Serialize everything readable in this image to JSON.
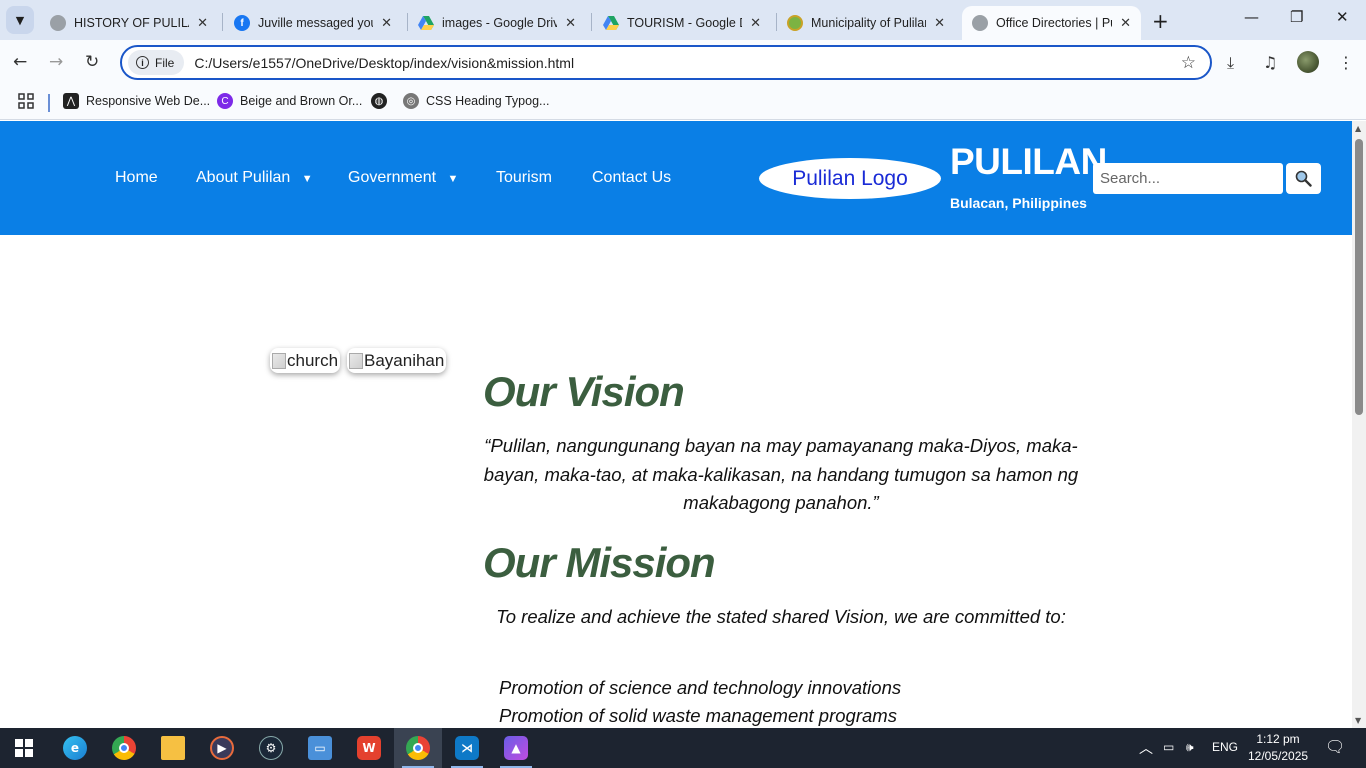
{
  "browser": {
    "tabs": [
      {
        "title": "HISTORY OF PULILAN",
        "icon": "globe-icon"
      },
      {
        "title": "Juville messaged you",
        "icon": "facebook-icon"
      },
      {
        "title": "images - Google Drive",
        "icon": "google-drive-icon"
      },
      {
        "title": "TOURISM - Google Drive",
        "icon": "google-drive-icon"
      },
      {
        "title": "Municipality of Pulilan",
        "icon": "pulilan-seal-icon"
      },
      {
        "title": "Office Directories | Pulilan",
        "icon": "globe-icon",
        "active": true
      }
    ],
    "omnibox": {
      "chip_label": "File",
      "url": "C:/Users/e1557/OneDrive/Desktop/index/vision&mission.html"
    },
    "bookmarks": [
      {
        "label": "Responsive Web De...",
        "icon": "web-design-icon"
      },
      {
        "label": "Beige and Brown Or...",
        "icon": "canva-icon"
      },
      {
        "label": "",
        "icon": "globe-icon"
      },
      {
        "label": "CSS Heading Typog...",
        "icon": "css-icon"
      }
    ]
  },
  "site": {
    "nav": {
      "home": "Home",
      "about": "About Pulilan",
      "government": "Government",
      "tourism": "Tourism",
      "contact": "Contact Us",
      "dropdown_arrow": "▼"
    },
    "logo_alt": "Pulilan Logo",
    "brand_title": "PULILAN",
    "brand_subtitle": "Bulacan, Philippines",
    "search": {
      "placeholder": "Search..."
    },
    "images": {
      "church_alt": "church",
      "bayanihan_alt": "Bayanihan"
    },
    "vision": {
      "heading": "Our Vision",
      "text": "“Pulilan, nangungunang bayan na may pamayanang maka-Diyos, maka-bayan, maka-tao, at maka-kalikasan, na handang tumugon sa hamon ng makabagong panahon.”"
    },
    "mission": {
      "heading": "Our Mission",
      "intro": "To realize and achieve the stated shared Vision, we are committed to:",
      "items": [
        "Promotion of science and technology innovations",
        "Promotion of solid waste management programs"
      ]
    }
  },
  "taskbar": {
    "language": "ENG",
    "time": "1:12 pm",
    "date": "12/05/2025"
  },
  "colors": {
    "header_blue": "#0a7fe6",
    "heading_green": "#3b5e3f",
    "logo_text_blue": "#1a2bd6"
  }
}
